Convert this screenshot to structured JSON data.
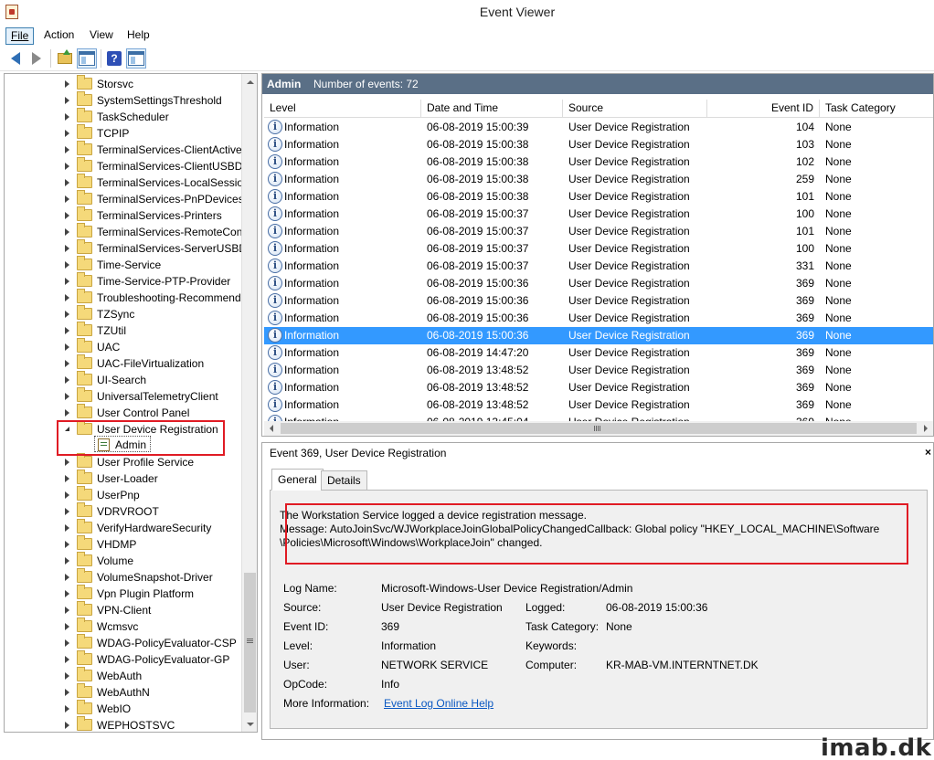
{
  "window": {
    "title": "Event Viewer"
  },
  "menu": [
    {
      "label": "File",
      "active": true
    },
    {
      "label": "Action"
    },
    {
      "label": "View"
    },
    {
      "label": "Help"
    }
  ],
  "toolbar": {
    "icons": [
      "back-arrow-icon",
      "forward-arrow-icon",
      "folder-up-icon",
      "show-hide-tree-icon",
      "help-icon",
      "show-hide-action-pane-icon"
    ]
  },
  "tree": {
    "items": [
      "Storsvc",
      "SystemSettingsThreshold",
      "TaskScheduler",
      "TCPIP",
      "TerminalServices-ClientActive",
      "TerminalServices-ClientUSBDe",
      "TerminalServices-LocalSession",
      "TerminalServices-PnPDevices",
      "TerminalServices-Printers",
      "TerminalServices-RemoteCon",
      "TerminalServices-ServerUSBD",
      "Time-Service",
      "Time-Service-PTP-Provider",
      "Troubleshooting-Recommende",
      "TZSync",
      "TZUtil",
      "UAC",
      "UAC-FileVirtualization",
      "UI-Search",
      "UniversalTelemetryClient",
      "User Control Panel",
      "User Device Registration",
      "User Profile Service",
      "User-Loader",
      "UserPnp",
      "VDRVROOT",
      "VerifyHardwareSecurity",
      "VHDMP",
      "Volume",
      "VolumeSnapshot-Driver",
      "Vpn Plugin Platform",
      "VPN-Client",
      "Wcmsvc",
      "WDAG-PolicyEvaluator-CSP",
      "WDAG-PolicyEvaluator-GP",
      "WebAuth",
      "WebAuthN",
      "WebIO",
      "WEPHOSTSVC"
    ],
    "expanded_item": "User Device Registration",
    "child_log": "Admin"
  },
  "list": {
    "title": "Admin",
    "count_text": "Number of events: 72",
    "columns": [
      "Level",
      "Date and Time",
      "Source",
      "Event ID",
      "Task Category"
    ],
    "selected_index": 12,
    "rows": [
      {
        "level": "Information",
        "date": "06-08-2019 15:00:39",
        "source": "User Device Registration",
        "id": "104",
        "category": "None"
      },
      {
        "level": "Information",
        "date": "06-08-2019 15:00:38",
        "source": "User Device Registration",
        "id": "103",
        "category": "None"
      },
      {
        "level": "Information",
        "date": "06-08-2019 15:00:38",
        "source": "User Device Registration",
        "id": "102",
        "category": "None"
      },
      {
        "level": "Information",
        "date": "06-08-2019 15:00:38",
        "source": "User Device Registration",
        "id": "259",
        "category": "None"
      },
      {
        "level": "Information",
        "date": "06-08-2019 15:00:38",
        "source": "User Device Registration",
        "id": "101",
        "category": "None"
      },
      {
        "level": "Information",
        "date": "06-08-2019 15:00:37",
        "source": "User Device Registration",
        "id": "100",
        "category": "None"
      },
      {
        "level": "Information",
        "date": "06-08-2019 15:00:37",
        "source": "User Device Registration",
        "id": "101",
        "category": "None"
      },
      {
        "level": "Information",
        "date": "06-08-2019 15:00:37",
        "source": "User Device Registration",
        "id": "100",
        "category": "None"
      },
      {
        "level": "Information",
        "date": "06-08-2019 15:00:37",
        "source": "User Device Registration",
        "id": "331",
        "category": "None"
      },
      {
        "level": "Information",
        "date": "06-08-2019 15:00:36",
        "source": "User Device Registration",
        "id": "369",
        "category": "None"
      },
      {
        "level": "Information",
        "date": "06-08-2019 15:00:36",
        "source": "User Device Registration",
        "id": "369",
        "category": "None"
      },
      {
        "level": "Information",
        "date": "06-08-2019 15:00:36",
        "source": "User Device Registration",
        "id": "369",
        "category": "None"
      },
      {
        "level": "Information",
        "date": "06-08-2019 15:00:36",
        "source": "User Device Registration",
        "id": "369",
        "category": "None"
      },
      {
        "level": "Information",
        "date": "06-08-2019 14:47:20",
        "source": "User Device Registration",
        "id": "369",
        "category": "None"
      },
      {
        "level": "Information",
        "date": "06-08-2019 13:48:52",
        "source": "User Device Registration",
        "id": "369",
        "category": "None"
      },
      {
        "level": "Information",
        "date": "06-08-2019 13:48:52",
        "source": "User Device Registration",
        "id": "369",
        "category": "None"
      },
      {
        "level": "Information",
        "date": "06-08-2019 13:48:52",
        "source": "User Device Registration",
        "id": "369",
        "category": "None"
      },
      {
        "level": "Information",
        "date": "06-08-2019 13:45:04",
        "source": "User Device Registration",
        "id": "369",
        "category": "None"
      }
    ]
  },
  "detail": {
    "title": "Event 369, User Device Registration",
    "tabs": [
      "General",
      "Details"
    ],
    "message_line1": "The Workstation Service logged a device registration message.",
    "message_line2": "Message: AutoJoinSvc/WJWorkplaceJoinGlobalPolicyChangedCallback: Global policy \"HKEY_LOCAL_MACHINE\\Software",
    "message_line3": "\\Policies\\Microsoft\\Windows\\WorkplaceJoin\" changed.",
    "labels": {
      "log_name": "Log Name:",
      "source": "Source:",
      "event_id": "Event ID:",
      "level": "Level:",
      "user": "User:",
      "opcode": "OpCode:",
      "more_info": "More Information:",
      "logged": "Logged:",
      "task_category": "Task Category:",
      "keywords": "Keywords:",
      "computer": "Computer:"
    },
    "values": {
      "log_name": "Microsoft-Windows-User Device Registration/Admin",
      "source": "User Device Registration",
      "event_id": "369",
      "level": "Information",
      "user": "NETWORK SERVICE",
      "opcode": "Info",
      "more_info": "Event Log Online Help",
      "logged": "06-08-2019 15:00:36",
      "task_category": "None",
      "keywords": "",
      "computer": "KR-MAB-VM.INTERNTNET.DK"
    }
  },
  "watermark": "imab.dk",
  "colors": {
    "list_header": "#5a6f86",
    "selection": "#3399ff",
    "highlight": "#e01b24",
    "link": "#0a58c2"
  }
}
